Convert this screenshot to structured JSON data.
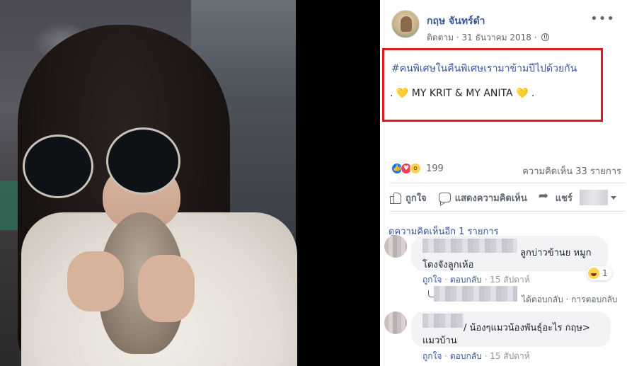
{
  "post": {
    "author": "กฤษ จันทร์ดำ",
    "follow": "ติดตาม",
    "date": "31 ธันวาคม 2018",
    "separator": " · ",
    "text_line1": "#คนพิเศษในคืนพิเศษเรามาข้ามปีไปด้วยกัน",
    "text_line2": ". 💛 MY KRIT & MY ANITA 💛 .",
    "more_glyph": "•••"
  },
  "stats": {
    "reaction_count": "199",
    "comment_count": "ความคิดเห็น 33 รายการ"
  },
  "actions": {
    "like": "ถูกใจ",
    "comment": "แสดงความคิดเห็น",
    "share": "แชร์"
  },
  "comments": {
    "more_link": "ดูความคิดเห็นอีก 1 รายการ",
    "items": [
      {
        "text_line1": "ลูกบ่าวข้านย หมูก",
        "text_line2": "โดงจังลูกเห้อ",
        "like": "ถูกใจ",
        "reply": "ตอบกลับ",
        "time": "15 สัปดาห์",
        "reaction_count": "1",
        "reply_summary": "ได้ตอบกลับ · การตอบกลับ"
      },
      {
        "text_line1": "/ น้องๆแมวน้องพันธุ์อะไร กฤษ>",
        "text_line2": "แมวบ้าน",
        "like": "ถูกใจ",
        "reply": "ตอบกลับ",
        "time": "15 สัปดาห์"
      }
    ]
  },
  "colors": {
    "highlight_border": "#e0191e",
    "link": "#385898",
    "muted": "#616770"
  }
}
